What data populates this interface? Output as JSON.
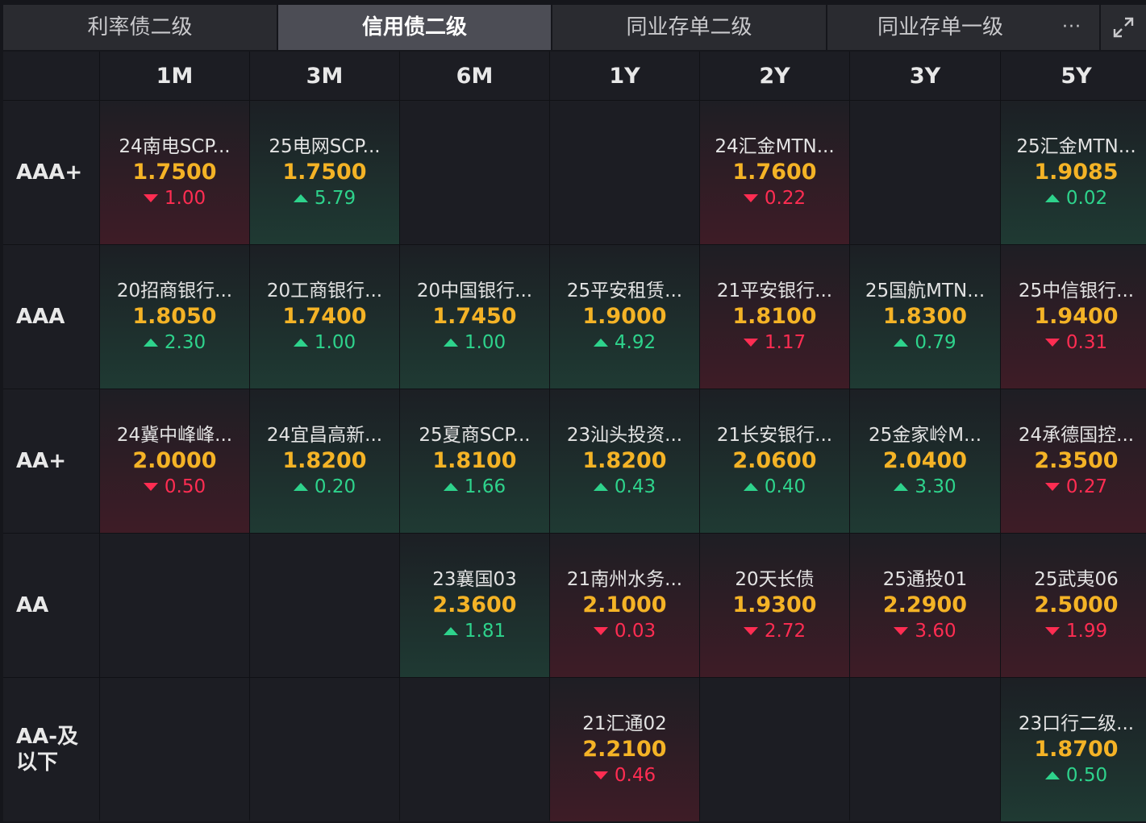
{
  "tabs": [
    {
      "label": "利率债二级",
      "active": false
    },
    {
      "label": "信用债二级",
      "active": true
    },
    {
      "label": "同业存单二级",
      "active": false
    },
    {
      "label": "同业存单一级",
      "active": false
    }
  ],
  "tab_more": "···",
  "icons": {
    "more": "more-dots-icon",
    "expand": "expand-icon"
  },
  "colors": {
    "up": "#2ed38c",
    "down": "#ff2d52",
    "yield": "#f4b326",
    "active_tab": "#4c4d55"
  },
  "columns": [
    "1M",
    "3M",
    "6M",
    "1Y",
    "2Y",
    "3Y",
    "5Y"
  ],
  "rows": [
    {
      "rating": "AAA+",
      "cells": [
        {
          "name": "24南电SCP...",
          "yield": "1.7500",
          "change": "1.00",
          "dir": "down"
        },
        {
          "name": "25电网SCP...",
          "yield": "1.7500",
          "change": "5.79",
          "dir": "up"
        },
        null,
        null,
        {
          "name": "24汇金MTN...",
          "yield": "1.7600",
          "change": "0.22",
          "dir": "down"
        },
        null,
        {
          "name": "25汇金MTN...",
          "yield": "1.9085",
          "change": "0.02",
          "dir": "up"
        }
      ]
    },
    {
      "rating": "AAA",
      "cells": [
        {
          "name": "20招商银行...",
          "yield": "1.8050",
          "change": "2.30",
          "dir": "up"
        },
        {
          "name": "20工商银行...",
          "yield": "1.7400",
          "change": "1.00",
          "dir": "up"
        },
        {
          "name": "20中国银行...",
          "yield": "1.7450",
          "change": "1.00",
          "dir": "up"
        },
        {
          "name": "25平安租赁...",
          "yield": "1.9000",
          "change": "4.92",
          "dir": "up"
        },
        {
          "name": "21平安银行...",
          "yield": "1.8100",
          "change": "1.17",
          "dir": "down"
        },
        {
          "name": "25国航MTN...",
          "yield": "1.8300",
          "change": "0.79",
          "dir": "up"
        },
        {
          "name": "25中信银行...",
          "yield": "1.9400",
          "change": "0.31",
          "dir": "down"
        }
      ]
    },
    {
      "rating": "AA+",
      "cells": [
        {
          "name": "24冀中峰峰...",
          "yield": "2.0000",
          "change": "0.50",
          "dir": "down"
        },
        {
          "name": "24宜昌高新...",
          "yield": "1.8200",
          "change": "0.20",
          "dir": "up"
        },
        {
          "name": "25夏商SCP...",
          "yield": "1.8100",
          "change": "1.66",
          "dir": "up"
        },
        {
          "name": "23汕头投资...",
          "yield": "1.8200",
          "change": "0.43",
          "dir": "up"
        },
        {
          "name": "21长安银行...",
          "yield": "2.0600",
          "change": "0.40",
          "dir": "up"
        },
        {
          "name": "25金家岭M...",
          "yield": "2.0400",
          "change": "3.30",
          "dir": "up"
        },
        {
          "name": "24承德国控...",
          "yield": "2.3500",
          "change": "0.27",
          "dir": "down"
        }
      ]
    },
    {
      "rating": "AA",
      "cells": [
        null,
        null,
        {
          "name": "23襄国03",
          "yield": "2.3600",
          "change": "1.81",
          "dir": "up"
        },
        {
          "name": "21南州水务...",
          "yield": "2.1000",
          "change": "0.03",
          "dir": "down"
        },
        {
          "name": "20天长债",
          "yield": "1.9300",
          "change": "2.72",
          "dir": "down"
        },
        {
          "name": "25通投01",
          "yield": "2.2900",
          "change": "3.60",
          "dir": "down"
        },
        {
          "name": "25武夷06",
          "yield": "2.5000",
          "change": "1.99",
          "dir": "down"
        }
      ]
    },
    {
      "rating": "AA-及\n以下",
      "cells": [
        null,
        null,
        null,
        {
          "name": "21汇通02",
          "yield": "2.2100",
          "change": "0.46",
          "dir": "down"
        },
        null,
        null,
        {
          "name": "23口行二级...",
          "yield": "1.8700",
          "change": "0.50",
          "dir": "up"
        }
      ]
    }
  ]
}
